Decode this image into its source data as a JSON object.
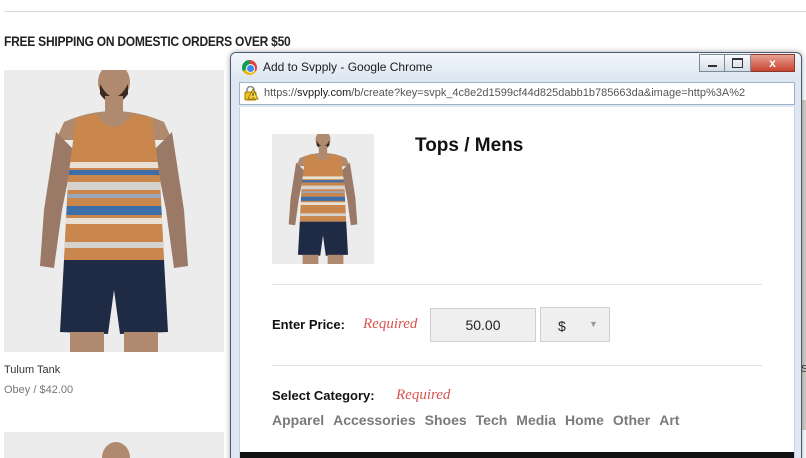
{
  "store": {
    "banner": "FREE SHIPPING ON DOMESTIC ORDERS OVER $50",
    "product": {
      "name": "Tulum Tank",
      "brand_price": "Obey / $42.00"
    },
    "edge_fragment": "S"
  },
  "window": {
    "title": "Add to Svpply - Google Chrome",
    "url_scheme": "https://",
    "url_host": "svpply.com",
    "url_rest": "/b/create?key=svpk_4c8e2d1599cf44d825dabb1b785663da&image=http%3A%2",
    "close_glyph": "x",
    "icons": [
      "chrome-icon",
      "minimize-icon",
      "maximize-icon",
      "close-icon",
      "warning-icon"
    ]
  },
  "form": {
    "category_title": "Tops / Mens",
    "price_label": "Enter Price:",
    "required_text": "Required",
    "price_value": "50.00",
    "currency": "$",
    "currency_arrow": "▼",
    "category_label": "Select Category:",
    "categories": [
      "Apparel",
      "Accessories",
      "Shoes",
      "Tech",
      "Media",
      "Home",
      "Other",
      "Art"
    ]
  },
  "colors": {
    "required": "#d9534f",
    "category_link": "#7a7a7a",
    "shirt_orange": "#c9874e",
    "shirt_blue": "#3d6ea8",
    "shorts": "#1f2a44"
  }
}
